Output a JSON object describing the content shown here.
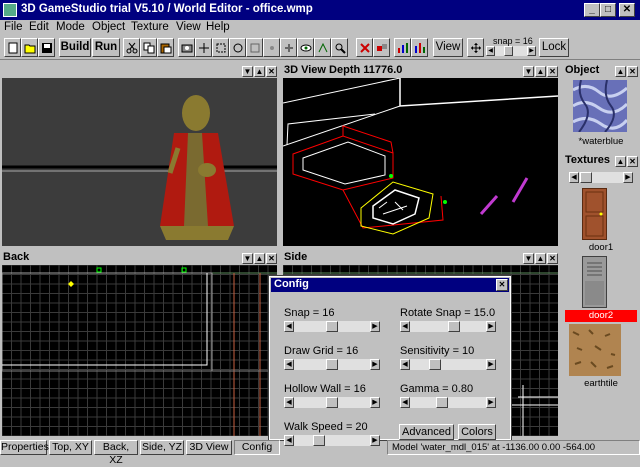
{
  "window": {
    "title": "3D GameStudio trial V5.10 / World Editor - office.wmp"
  },
  "menu": [
    "File",
    "Edit",
    "Mode",
    "Object",
    "Texture",
    "View",
    "Help"
  ],
  "toolbar": {
    "build_label": "Build",
    "run_label": "Run",
    "view_label": "View",
    "snap_label": "snap = 16",
    "lock_label": "Lock"
  },
  "views": {
    "top_left": {
      "title": ""
    },
    "view3d": {
      "title": "3D View Depth 11776.0"
    },
    "back": {
      "title": "Back"
    },
    "side": {
      "title": "Side"
    }
  },
  "object_panel": {
    "title": "Object",
    "texture_name": "*waterblue"
  },
  "textures_panel": {
    "title": "Textures",
    "items": [
      {
        "name": "door1",
        "selected": false
      },
      {
        "name": "door2",
        "selected": true
      },
      {
        "name": "earthtile",
        "selected": false
      }
    ],
    "selected_color": "#ff0000"
  },
  "config": {
    "title": "Config",
    "settings": [
      {
        "label": "Snap = 16",
        "level": 0.5
      },
      {
        "label": "Rotate Snap = 15.0",
        "level": 0.6
      },
      {
        "label": "Draw Grid = 16",
        "level": 0.5
      },
      {
        "label": "Sensitivity = 10",
        "level": 0.3
      },
      {
        "label": "Hollow Wall = 16",
        "level": 0.5
      },
      {
        "label": "Gamma = 0.80",
        "level": 0.4
      },
      {
        "label": "Walk Speed = 20",
        "level": 0.3
      }
    ],
    "advanced_label": "Advanced",
    "colors_label": "Colors"
  },
  "tabs": [
    "Properties",
    "Top, XY",
    "Back, XZ",
    "Side, YZ",
    "3D View",
    "Config"
  ],
  "active_tab": "Config",
  "status": "Model 'water_mdl_015' at  -1136.00 0.00 -564.00",
  "colors": {
    "titlebar": "#000080",
    "grid": "#3a3a3a",
    "wire_red": "#ff0000",
    "wire_yellow": "#ffff00"
  }
}
